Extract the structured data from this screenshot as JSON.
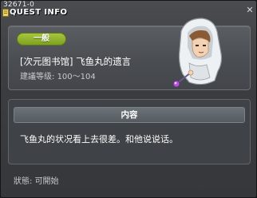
{
  "window": {
    "id": "32671-0",
    "title": "QUEST INFO"
  },
  "quest": {
    "category": "一般",
    "title": "[次元图书馆] 飞鱼丸的遗言",
    "level_label": "建議等级:",
    "level_range": "100～104"
  },
  "content": {
    "header": "内容",
    "text": "飞鱼丸的状况看上去很差。和他说说话。"
  },
  "status": {
    "label": "狀態:",
    "value": "可開始"
  },
  "colors": {
    "badge": "#8fb02c",
    "panel": "#4a4d52",
    "content_header": "#5f666b"
  },
  "icons": [
    "quest-book-icon",
    "close-icon"
  ]
}
